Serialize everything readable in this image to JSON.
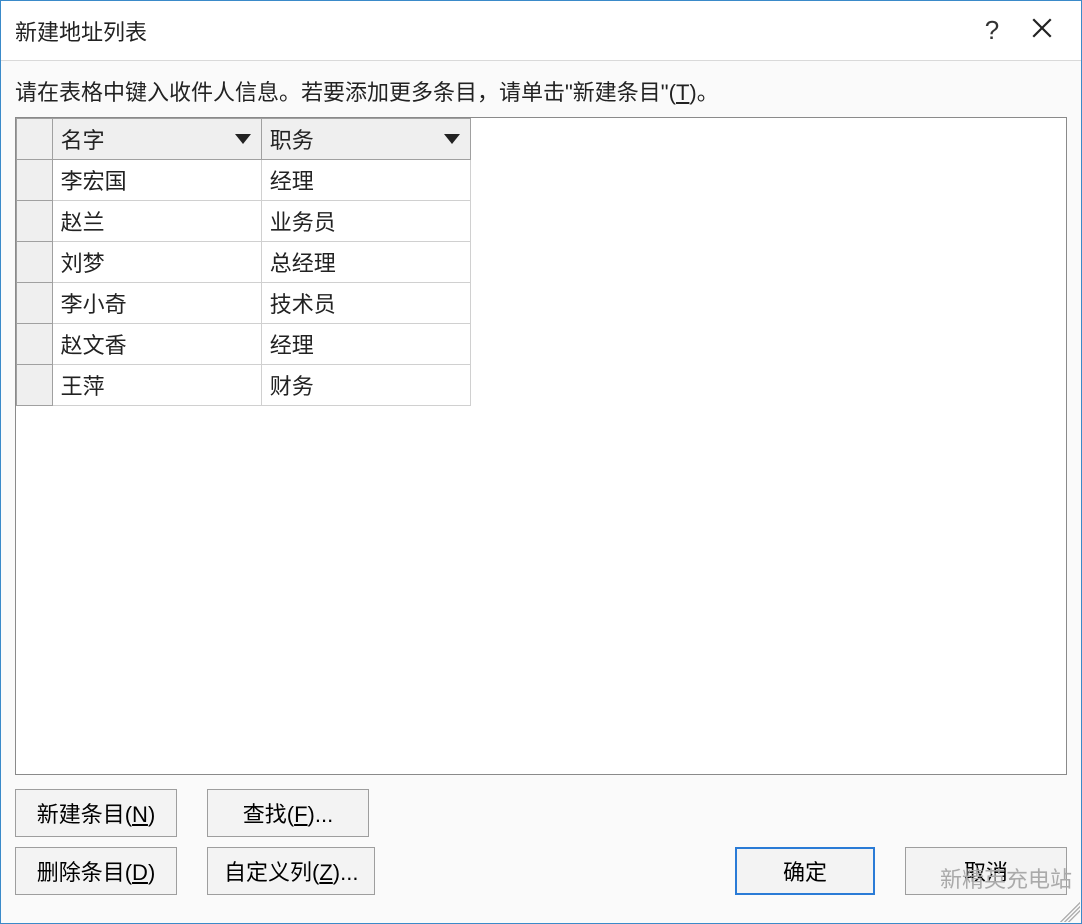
{
  "dialog": {
    "title": "新建地址列表",
    "help_label": "?",
    "instructions_prefix": "请在表格中键入收件人信息。若要添加更多条目，请单击\"新建条目\"(",
    "instructions_hotkey": "T",
    "instructions_suffix": ")。"
  },
  "table": {
    "columns": [
      {
        "label": "名字"
      },
      {
        "label": "职务"
      }
    ],
    "rows": [
      {
        "name": "李宏国",
        "role": "经理"
      },
      {
        "name": "赵兰",
        "role": "业务员"
      },
      {
        "name": "刘梦",
        "role": "总经理"
      },
      {
        "name": "李小奇",
        "role": "技术员"
      },
      {
        "name": "赵文香",
        "role": "经理"
      },
      {
        "name": "王萍",
        "role": "财务"
      }
    ]
  },
  "buttons": {
    "new_entry_label": "新建条目(",
    "new_entry_hotkey": "N",
    "new_entry_suffix": ")",
    "find_label": "查找(",
    "find_hotkey": "F",
    "find_suffix": ")...",
    "delete_label": "删除条目(",
    "delete_hotkey": "D",
    "delete_suffix": ")",
    "custom_cols_label": "自定义列(",
    "custom_cols_hotkey": "Z",
    "custom_cols_suffix": ")...",
    "ok_label": "确定",
    "cancel_label": "取消"
  },
  "watermark": "新精英充电站"
}
